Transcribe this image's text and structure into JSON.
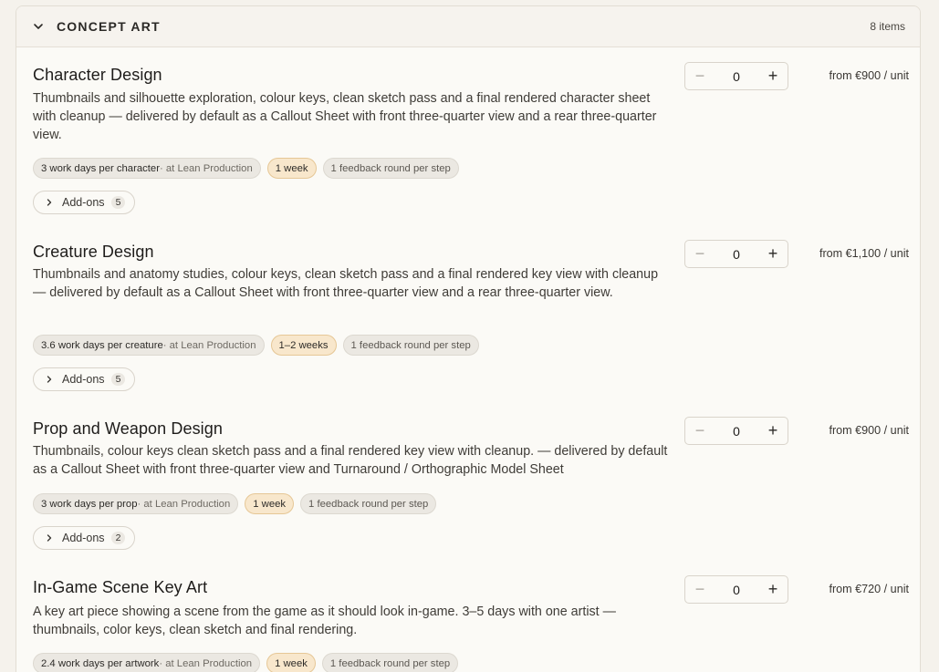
{
  "section": {
    "title": "CONCEPT ART",
    "count": "8 items"
  },
  "items": [
    {
      "title": "Character Design",
      "description": "Thumbnails and silhouette exploration, colour keys, clean sketch pass and a final rendered character sheet with cleanup — delivered by default as a Callout Sheet with front three-quarter view and a rear three-quarter view.",
      "workdays": "3 work days per character",
      "tier": " · at Lean Production",
      "duration": "1 week",
      "feedback": "1 feedback round per step",
      "addons_label": "Add-ons",
      "addons_count": "5",
      "quantity": "0",
      "price": "from €900 / unit"
    },
    {
      "title": "Creature Design",
      "description": "Thumbnails and anatomy studies, colour keys, clean sketch pass and a final rendered key view with cleanup — delivered by default as a Callout Sheet with front three-quarter view and a rear three-quarter view.",
      "workdays": "3.6 work days per creature",
      "tier": " · at Lean Production",
      "duration": "1–2 weeks",
      "feedback": "1 feedback round per step",
      "addons_label": "Add-ons",
      "addons_count": "5",
      "quantity": "0",
      "price": "from €1,100 / unit"
    },
    {
      "title": "Prop and Weapon Design",
      "description": "Thumbnails, colour keys clean sketch pass and a final rendered key view with cleanup. — delivered by default as a Callout Sheet with front three-quarter view and Turnaround / Orthographic Model Sheet",
      "workdays": "3 work days per prop",
      "tier": " · at Lean Production",
      "duration": "1 week",
      "feedback": "1 feedback round per step",
      "addons_label": "Add-ons",
      "addons_count": "2",
      "quantity": "0",
      "price": "from €900 / unit"
    },
    {
      "title": "In-Game Scene Key Art",
      "description": "A key art piece showing a scene from the game as it should look in-game. 3–5 days with one artist — thumbnails, color keys, clean sketch and final rendering.",
      "workdays": "2.4 work days per artwork",
      "tier": " · at Lean Production",
      "duration": "1 week",
      "feedback": "1 feedback round per step",
      "quantity": "0",
      "price": "from €720 / unit"
    }
  ],
  "stepper": {
    "minus": "−",
    "plus": "+"
  }
}
